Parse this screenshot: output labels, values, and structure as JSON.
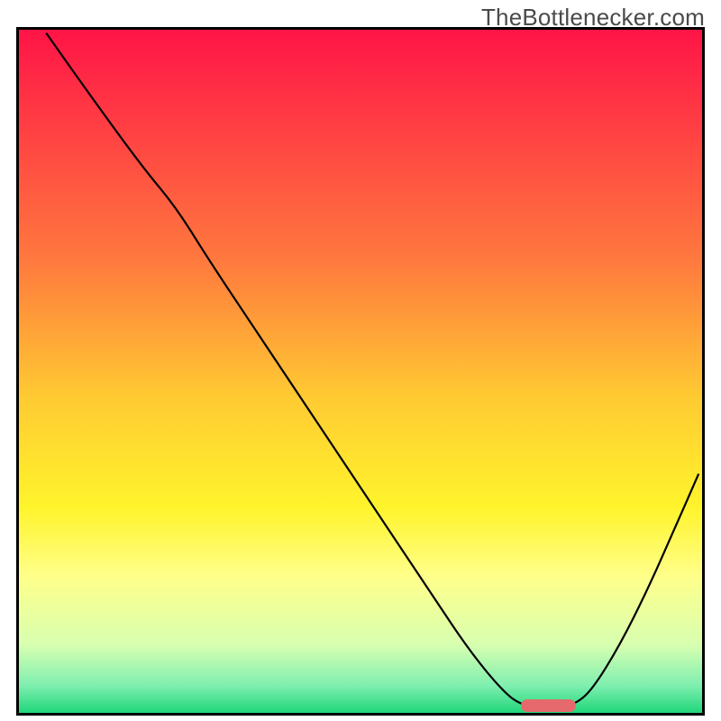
{
  "watermark": {
    "label": "TheBottlenecker.com"
  },
  "chart_data": {
    "type": "line",
    "title": "",
    "xlabel": "",
    "ylabel": "",
    "xlim": [
      0,
      100
    ],
    "ylim": [
      0,
      100
    ],
    "grid": false,
    "gradient_stops": [
      {
        "offset": 0,
        "color": "#ff1447"
      },
      {
        "offset": 34,
        "color": "#ff7a3e"
      },
      {
        "offset": 54,
        "color": "#ffcb32"
      },
      {
        "offset": 70,
        "color": "#fff42c"
      },
      {
        "offset": 80,
        "color": "#ffff8a"
      },
      {
        "offset": 90,
        "color": "#d8ffb0"
      },
      {
        "offset": 96,
        "color": "#7fefb0"
      },
      {
        "offset": 100,
        "color": "#20d67a"
      }
    ],
    "series": [
      {
        "name": "bottleneck-curve",
        "color": "#000000",
        "stroke_width": 2.2,
        "points": [
          {
            "x": 4.0,
            "y": 99.5
          },
          {
            "x": 10.0,
            "y": 91.0
          },
          {
            "x": 18.0,
            "y": 80.0
          },
          {
            "x": 23.0,
            "y": 74.0
          },
          {
            "x": 28.0,
            "y": 66.0
          },
          {
            "x": 36.0,
            "y": 54.0
          },
          {
            "x": 44.0,
            "y": 42.0
          },
          {
            "x": 52.0,
            "y": 30.0
          },
          {
            "x": 60.0,
            "y": 18.0
          },
          {
            "x": 66.0,
            "y": 9.0
          },
          {
            "x": 71.0,
            "y": 3.0
          },
          {
            "x": 73.5,
            "y": 1.2
          },
          {
            "x": 76.0,
            "y": 0.9
          },
          {
            "x": 79.0,
            "y": 0.9
          },
          {
            "x": 81.5,
            "y": 1.3
          },
          {
            "x": 84.0,
            "y": 3.5
          },
          {
            "x": 88.0,
            "y": 10.0
          },
          {
            "x": 92.0,
            "y": 18.0
          },
          {
            "x": 96.0,
            "y": 27.0
          },
          {
            "x": 99.5,
            "y": 35.0
          }
        ]
      }
    ],
    "marker": {
      "name": "optimal-range-marker",
      "color": "#e66a6d",
      "x_start": 73.5,
      "x_end": 81.5,
      "y": 1.1
    }
  }
}
